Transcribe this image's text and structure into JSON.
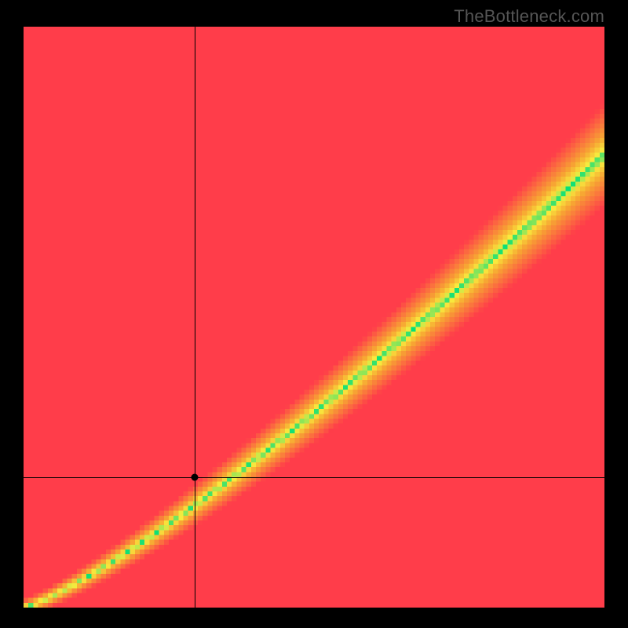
{
  "watermark": "TheBottleneck.com",
  "chart_data": {
    "type": "heatmap",
    "title": "",
    "xlabel": "",
    "ylabel": "",
    "xlim": [
      0,
      1
    ],
    "ylim": [
      0,
      1
    ],
    "grid": false,
    "legend": false,
    "crosshair": {
      "x": 0.295,
      "y": 0.225
    },
    "marker": {
      "x": 0.295,
      "y": 0.225
    },
    "band": {
      "description": "Primary green optimum band along y ≈ a*x^p with widening tolerance toward top-right; surrounded by yellow falloff, fading to red.",
      "a": 0.78,
      "p": 1.22,
      "half_width_at_0": 0.015,
      "half_width_at_1": 0.09
    },
    "colors": {
      "green": "#00E07A",
      "yellow": "#F9EB3E",
      "orange": "#F7A733",
      "red": "#FF3D4A"
    },
    "resolution": 120
  }
}
